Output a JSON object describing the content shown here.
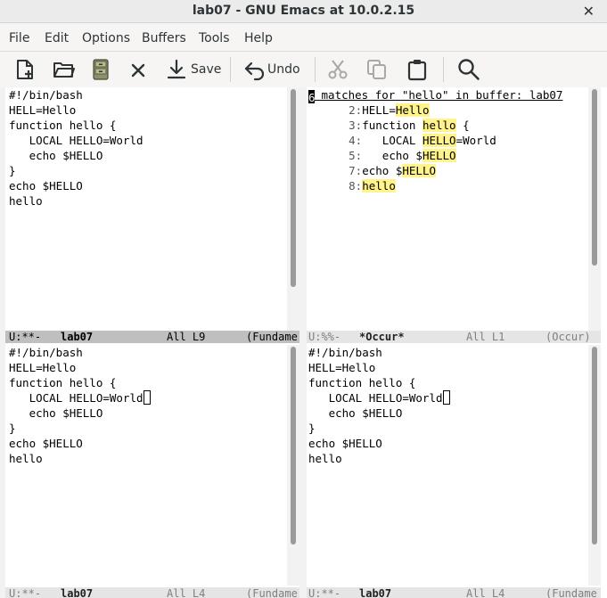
{
  "window": {
    "title": "lab07 - GNU Emacs at 10.0.2.15",
    "close_label": "✕"
  },
  "menu": {
    "items": [
      "File",
      "Edit",
      "Options",
      "Buffers",
      "Tools",
      "Help"
    ]
  },
  "toolbar": {
    "save_label": "Save",
    "undo_label": "Undo"
  },
  "panes": {
    "top_left": {
      "lines": [
        "#!/bin/bash",
        "HELL=Hello",
        "function hello {",
        "   LOCAL HELLO=World",
        "   echo $HELLO",
        "}",
        "echo $HELLO",
        "hello"
      ],
      "modeline": {
        "state": "U:**-",
        "buffer": "lab07",
        "position": "All L9",
        "mode": "(Fundame"
      }
    },
    "top_right": {
      "header": "6 matches for \"hello\" in buffer: lab07",
      "matches": [
        {
          "num": "2:",
          "before": "HELL=",
          "match": "Hello",
          "after": ""
        },
        {
          "num": "3:",
          "before": "function ",
          "match": "hello",
          "after": " {"
        },
        {
          "num": "4:",
          "before": "   LOCAL ",
          "match": "HELLO",
          "after": "=World"
        },
        {
          "num": "5:",
          "before": "   echo $",
          "match": "HELLO",
          "after": ""
        },
        {
          "num": "7:",
          "before": "echo $",
          "match": "HELLO",
          "after": ""
        },
        {
          "num": "8:",
          "before": "",
          "match": "hello",
          "after": ""
        }
      ],
      "modeline": {
        "state": "U:%%-",
        "buffer": "*Occur*",
        "position": "All L1",
        "mode": "(Occur)"
      }
    },
    "bottom_left": {
      "lines": [
        "#!/bin/bash",
        "HELL=Hello",
        "function hello {",
        "   LOCAL HELLO=World",
        "   echo $HELLO",
        "}",
        "echo $HELLO",
        "hello"
      ],
      "modeline": {
        "state": "U:**-",
        "buffer": "lab07",
        "position": "All L4",
        "mode": "(Fundame"
      }
    },
    "bottom_right": {
      "lines": [
        "#!/bin/bash",
        "HELL=Hello",
        "function hello {",
        "   LOCAL HELLO=World",
        "   echo $HELLO",
        "}",
        "echo $HELLO",
        "hello"
      ],
      "modeline": {
        "state": "U:**-",
        "buffer": "lab07",
        "position": "All L4",
        "mode": "(Fundame"
      }
    }
  },
  "colors": {
    "match_highlight": "#fff38a",
    "modeline_active": "#bfbfbf",
    "modeline_inactive": "#e5e5e5"
  }
}
